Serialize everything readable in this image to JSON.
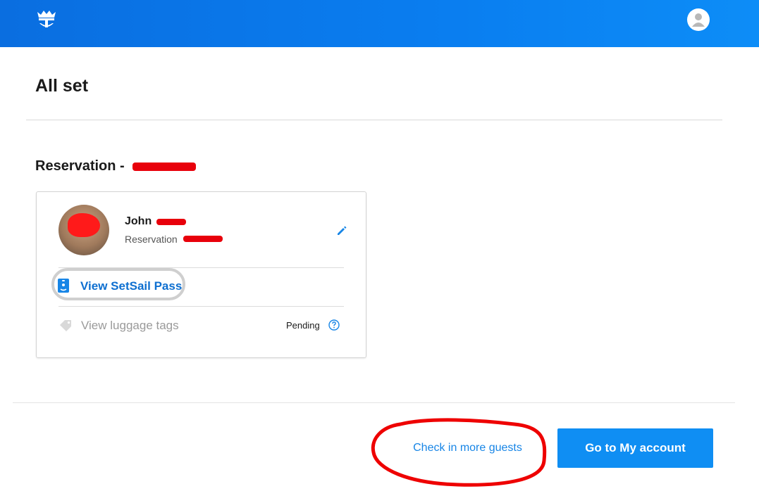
{
  "colors": {
    "header_blue": "#0a7ef0",
    "link_blue": "#0e6fd0",
    "button_blue": "#0f8ef3",
    "redaction_red": "#e8000b"
  },
  "header": {
    "logo_icon": "crown-anchor-icon",
    "account_icon": "user-avatar-icon"
  },
  "page": {
    "title": "All set"
  },
  "reservation": {
    "title_prefix": "Reservation - "
  },
  "guest": {
    "name_first": "John",
    "reservation_label": "Reservation",
    "edit_icon": "pencil-icon"
  },
  "actions": {
    "setsail_pass": "View SetSail Pass",
    "luggage_tags": "View luggage tags",
    "luggage_status": "Pending",
    "help_icon": "question-circle-icon"
  },
  "footer": {
    "check_in_more": "Check in more guests",
    "go_to_account": "Go to My account"
  }
}
